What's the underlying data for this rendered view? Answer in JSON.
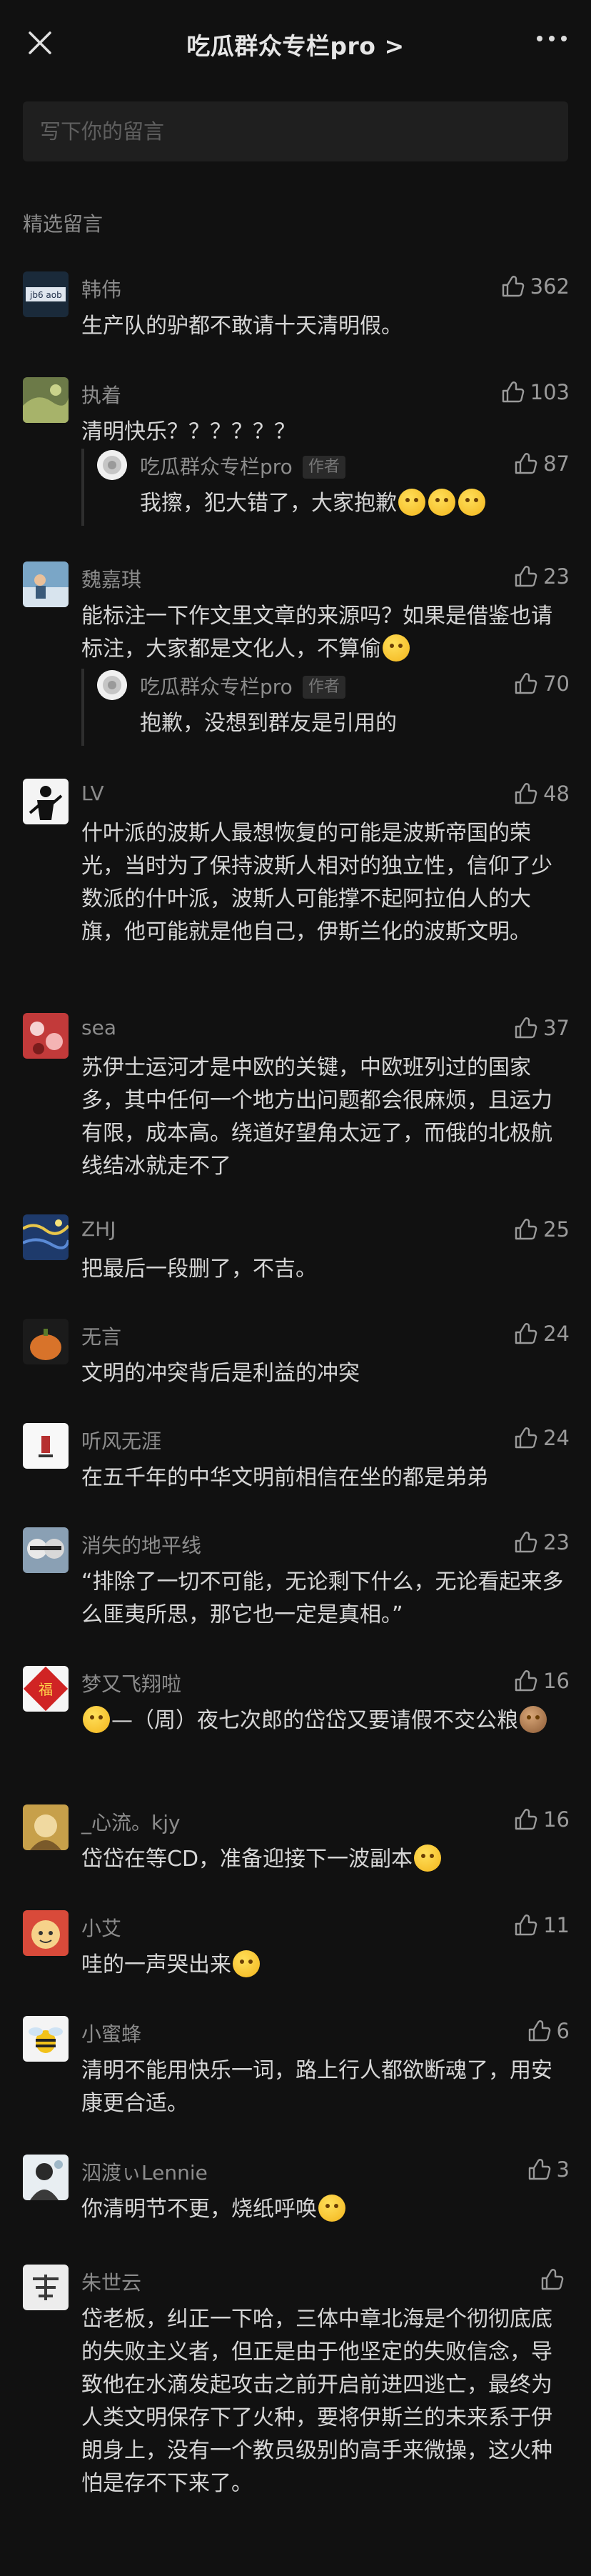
{
  "nav": {
    "title": "吃瓜群众专栏pro >",
    "close_icon": "close-icon",
    "more_icon": "more-icon"
  },
  "input": {
    "placeholder": "写下你的留言"
  },
  "section_title": "精选留言",
  "comments": [
    {
      "name": "韩伟",
      "likes": "362",
      "text": "生产队的驴都不敢请十天清明假。"
    },
    {
      "name": "执着",
      "likes": "103",
      "text": "清明快乐？？？？？？",
      "reply": {
        "name": "吃瓜群众专栏pro",
        "tag": "作者",
        "likes": "87",
        "text": "我擦，犯大错了，大家抱歉"
      }
    },
    {
      "name": "魏嘉琪",
      "likes": "23",
      "text": "能标注一下作文里文章的来源吗？如果是借鉴也请标注，大家都是文化人，不算偷",
      "reply": {
        "name": "吃瓜群众专栏pro",
        "tag": "作者",
        "likes": "70",
        "text": "抱歉，没想到群友是引用的"
      }
    },
    {
      "name": "LV",
      "likes": "48",
      "text": "什叶派的波斯人最想恢复的可能是波斯帝国的荣光，当时为了保持波斯人相对的独立性，信仰了少数派的什叶派，波斯人可能撑不起阿拉伯人的大旗，他可能就是他自己，伊斯兰化的波斯文明。"
    },
    {
      "name": "sea",
      "likes": "37",
      "text": "苏伊士运河才是中欧的关键，中欧班列过的国家多，其中任何一个地方出问题都会很麻烦，且运力有限，成本高。绕道好望角太远了，而俄的北极航线结冰就走不了"
    },
    {
      "name": "ZHJ",
      "likes": "25",
      "text": "把最后一段删了，不吉。"
    },
    {
      "name": "无言",
      "likes": "24",
      "text": "文明的冲突背后是利益的冲突"
    },
    {
      "name": "听风无涯",
      "likes": "24",
      "text": "在五千年的中华文明前相信在坐的都是弟弟"
    },
    {
      "name": "消失的地平线",
      "likes": "23",
      "text": "“排除了一切不可能，无论剩下什么，无论看起来多么匪夷所思，那它也一定是真相。”"
    },
    {
      "name": "梦又飞翔啦",
      "likes": "16",
      "text": "—（周）夜七次郎的岱岱又要请假不交公粮"
    },
    {
      "name": "_心流。kjy",
      "likes": "16",
      "text": "岱岱在等CD，准备迎接下一波副本"
    },
    {
      "name": "小艾",
      "likes": "11",
      "text": "哇的一声哭出来"
    },
    {
      "name": "小蜜蜂",
      "likes": "6",
      "text": "清明不能用快乐一词，路上行人都欲断魂了，用安康更合适。"
    },
    {
      "name": "泅渡ぃLennie",
      "likes": "3",
      "text": "你清明节不更，烧纸呼唤"
    },
    {
      "name": "朱世云",
      "likes": "",
      "text": "岱老板，纠正一下哈，三体中章北海是个彻彻底底的失败主义者，但正是由于他坚定的失败信念，导致他在水滴发起攻击之前开启前进四逃亡，最终为人类文明保存下了火种，要将伊斯兰的未来系于伊朗身上，没有一个教员级别的高手来微操，这火种怕是存不下来了。"
    }
  ],
  "colors": {
    "background": "#111111",
    "text": "#d6d6d6",
    "muted": "#8c8c8c",
    "input_bg": "#1f1f1f"
  }
}
